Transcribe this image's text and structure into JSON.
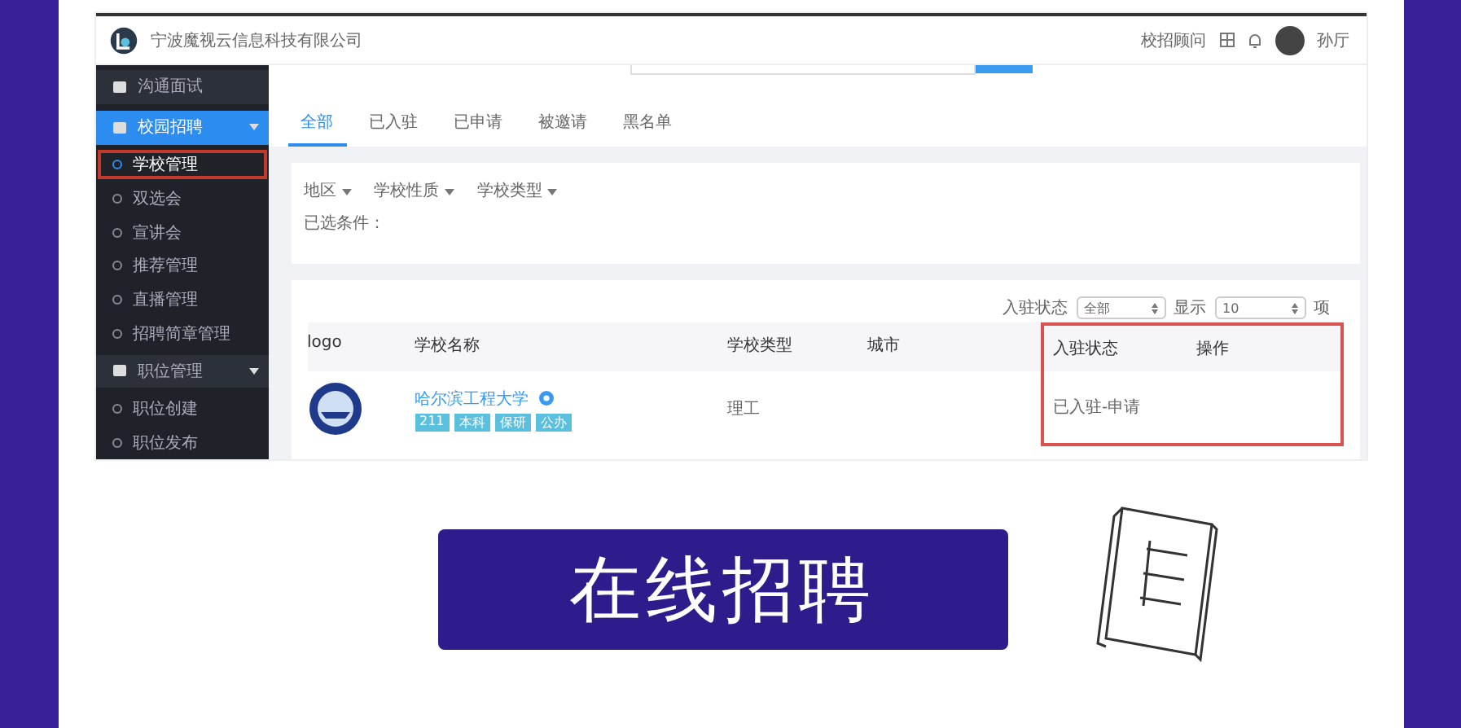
{
  "header": {
    "company": "宁波魔视云信息科技有限公司",
    "links": [
      "校招顾问"
    ],
    "user": "孙厅"
  },
  "sidebar": {
    "items": [
      {
        "kind": "group",
        "label": "沟通面试",
        "expanded": false,
        "selected": false,
        "highlighted": false
      },
      {
        "kind": "group",
        "label": "校园招聘",
        "expanded": true,
        "selected": true,
        "highlighted": false
      },
      {
        "kind": "item",
        "label": "学校管理",
        "selected": true,
        "highlighted": true
      },
      {
        "kind": "item",
        "label": "双选会",
        "selected": false,
        "highlighted": false
      },
      {
        "kind": "item",
        "label": "宣讲会",
        "selected": false,
        "highlighted": false
      },
      {
        "kind": "item",
        "label": "推荐管理",
        "selected": false,
        "highlighted": false
      },
      {
        "kind": "item",
        "label": "直播管理",
        "selected": false,
        "highlighted": false
      },
      {
        "kind": "item",
        "label": "招聘简章管理",
        "selected": false,
        "highlighted": false
      },
      {
        "kind": "group",
        "label": "职位管理",
        "expanded": true,
        "selected": false,
        "highlighted": false
      },
      {
        "kind": "item",
        "label": "职位创建",
        "selected": false,
        "highlighted": false
      },
      {
        "kind": "item",
        "label": "职位发布",
        "selected": false,
        "highlighted": false
      }
    ]
  },
  "tabs": [
    {
      "label": "全部",
      "selected": true
    },
    {
      "label": "已入驻",
      "selected": false
    },
    {
      "label": "已申请",
      "selected": false
    },
    {
      "label": "被邀请",
      "selected": false
    },
    {
      "label": "黑名单",
      "selected": false
    }
  ],
  "filters": {
    "dropdowns": [
      "地区",
      "学校性质",
      "学校类型"
    ],
    "selected_label": "已选条件："
  },
  "table": {
    "status_filter": {
      "label": "入驻状态",
      "value": "全部"
    },
    "page_size": {
      "label": "显示",
      "value": "10",
      "suffix": "项"
    },
    "columns": [
      {
        "label": "logo",
        "highlighted": false
      },
      {
        "label": "学校名称",
        "highlighted": false
      },
      {
        "label": "学校类型",
        "highlighted": false
      },
      {
        "label": "城市",
        "highlighted": false
      },
      {
        "label": "入驻状态",
        "highlighted": true
      },
      {
        "label": "操作",
        "highlighted": true
      }
    ],
    "rows": [
      {
        "name": "哈尔滨工程大学",
        "tags": [
          "211",
          "本科",
          "保研",
          "公办"
        ],
        "type": "理工",
        "city": "",
        "status": "已入驻-申请"
      }
    ]
  },
  "banner": {
    "title": "在线招聘"
  }
}
